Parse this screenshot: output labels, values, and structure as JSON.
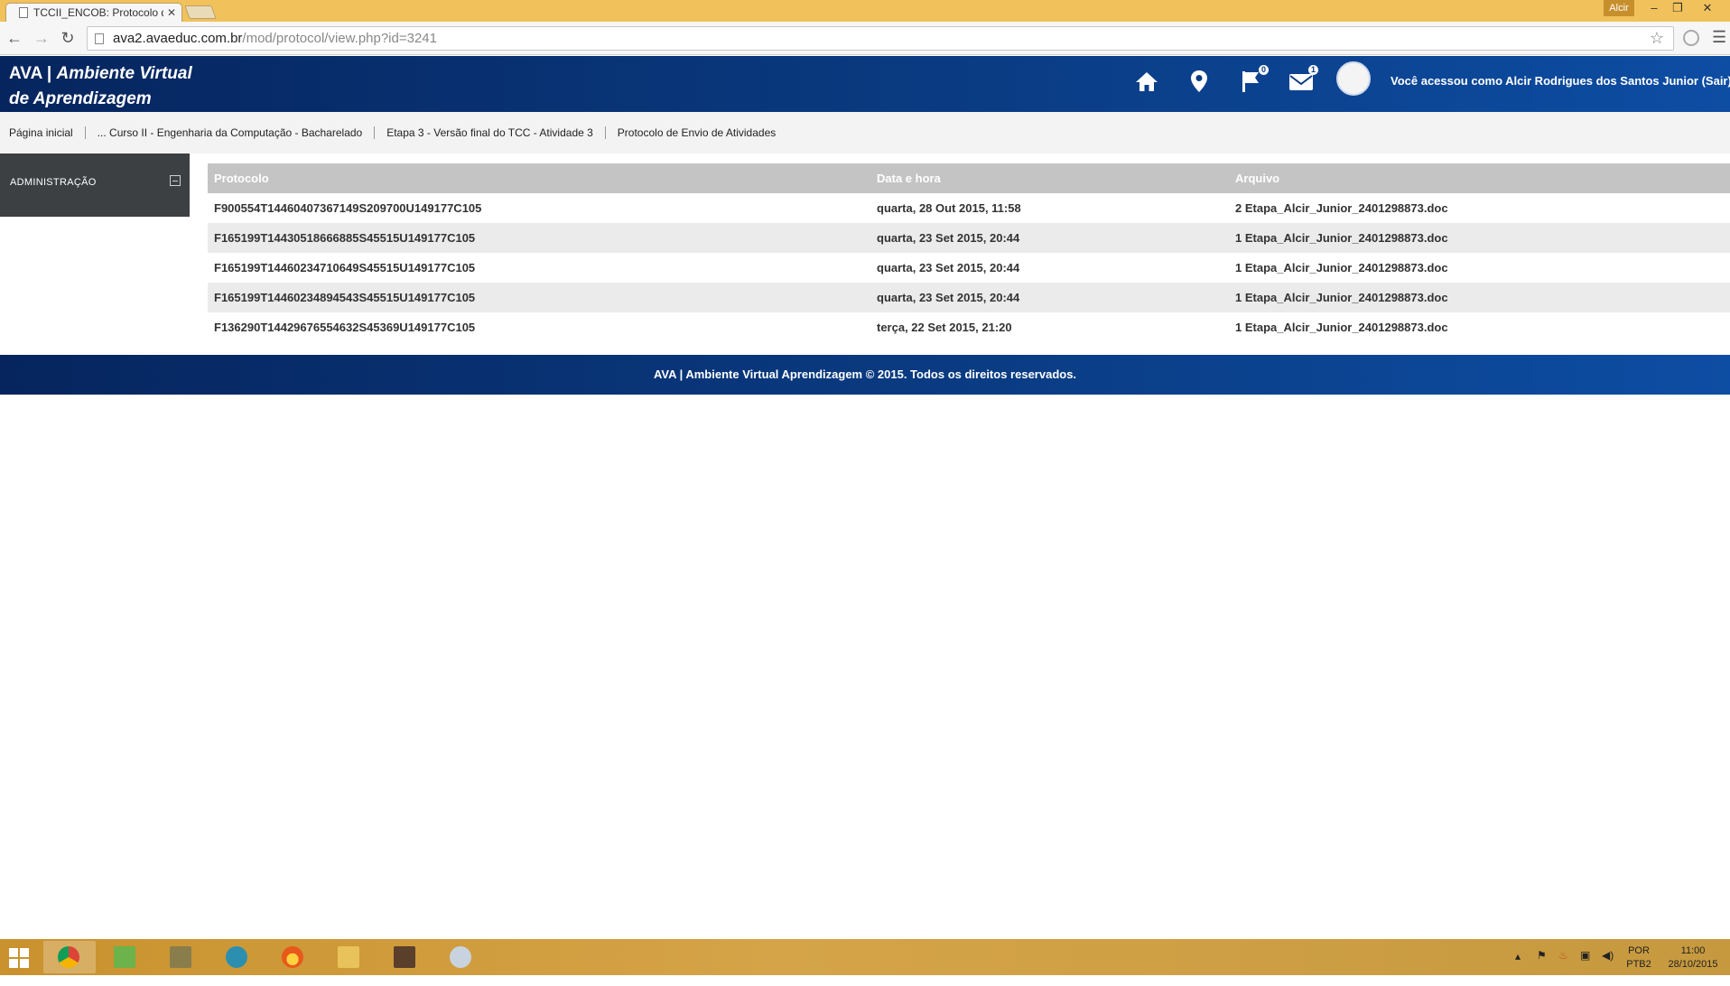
{
  "browser": {
    "tab_title": "TCCII_ENCOB: Protocolo d",
    "tab_close": "✕",
    "user_badge": "Alcir",
    "url_host": "ava2.avaeduc.com.br",
    "url_path": "/mod/protocol/view.php?id=3241"
  },
  "header": {
    "logo_brand": "AVA",
    "logo_sep": " | ",
    "logo_line1": "Ambiente Virtual",
    "logo_line2": "de Aprendizagem",
    "flag_badge": "0",
    "mail_badge": "1",
    "login_text": "Você acessou como Alcir Rodrigues dos Santos Junior (Sair)"
  },
  "breadcrumb": [
    "Página inicial",
    "... Curso II - Engenharia da Computação - Bacharelado",
    "Etapa 3 - Versão final do TCC - Atividade 3",
    "Protocolo de Envio de Atividades"
  ],
  "sidebar": {
    "admin_title": "ADMINISTRAÇÃO"
  },
  "table": {
    "headers": [
      "Protocolo",
      "Data e hora",
      "Arquivo"
    ],
    "rows": [
      [
        "F900554T14460407367149S209700U149177C105",
        "quarta, 28 Out 2015, 11:58",
        "2 Etapa_Alcir_Junior_2401298873.doc"
      ],
      [
        "F165199T14430518666885S45515U149177C105",
        "quarta, 23 Set 2015, 20:44",
        "1 Etapa_Alcir_Junior_2401298873.doc"
      ],
      [
        "F165199T14460234710649S45515U149177C105",
        "quarta, 23 Set 2015, 20:44",
        "1 Etapa_Alcir_Junior_2401298873.doc"
      ],
      [
        "F165199T14460234894543S45515U149177C105",
        "quarta, 23 Set 2015, 20:44",
        "1 Etapa_Alcir_Junior_2401298873.doc"
      ],
      [
        "F136290T14429676554632S45369U149177C105",
        "terça, 22 Set 2015, 21:20",
        "1 Etapa_Alcir_Junior_2401298873.doc"
      ]
    ]
  },
  "footer": {
    "text": "AVA | Ambiente Virtual Aprendizagem © 2015. Todos os direitos reservados."
  },
  "taskbar": {
    "lang_line1": "POR",
    "lang_line2": "PTB2",
    "time": "11:00",
    "date": "28/10/2015"
  },
  "colors": {
    "header_blue": "#0a3b82",
    "sidebar_dark": "#3c4043",
    "table_header": "#c4c4c4",
    "row_alt": "#ebebeb",
    "taskbar_gold": "#d5a448"
  }
}
